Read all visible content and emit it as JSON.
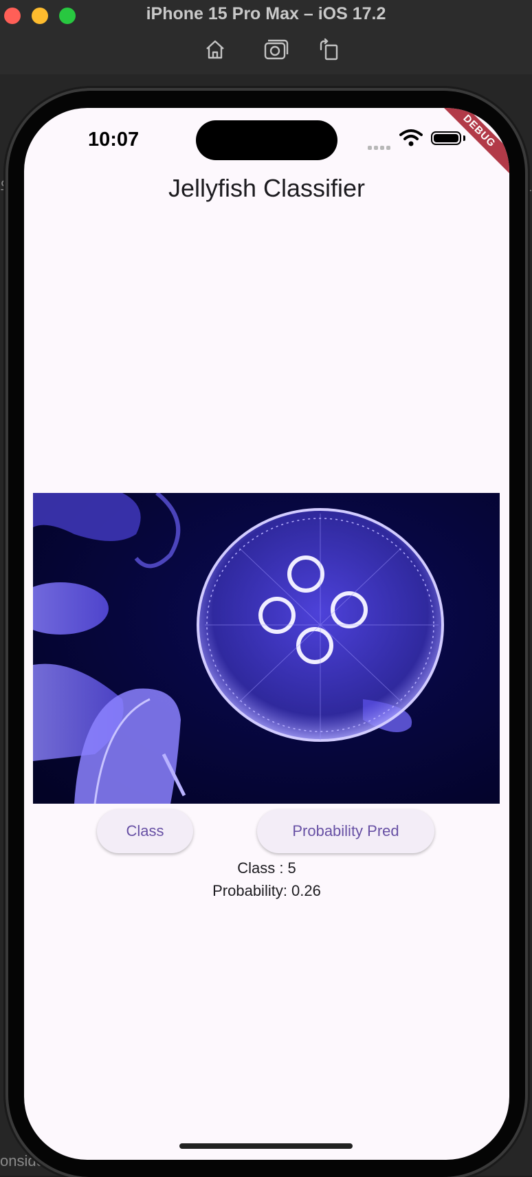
{
  "window": {
    "title": "iPhone 15 Pro Max – iOS 17.2",
    "toolbar": [
      "home-icon",
      "screenshot-icon",
      "rotate-icon"
    ]
  },
  "background": {
    "left_text": "의영",
    "right_text": "마크",
    "bottom_text": "onside"
  },
  "status_bar": {
    "time": "10:07"
  },
  "debug_banner": "DEBUG",
  "app": {
    "title": "Jellyfish Classifier",
    "buttons": {
      "class_label": "Class",
      "probability_label": "Probability Pred"
    },
    "result": {
      "class_text": "Class : 5",
      "probability_text": "Probability: 0.26"
    }
  },
  "colors": {
    "button_bg": "#f3edf7",
    "button_text": "#6750a4",
    "debug_red": "#b23a48",
    "screen_bg": "#fdf8fd"
  }
}
